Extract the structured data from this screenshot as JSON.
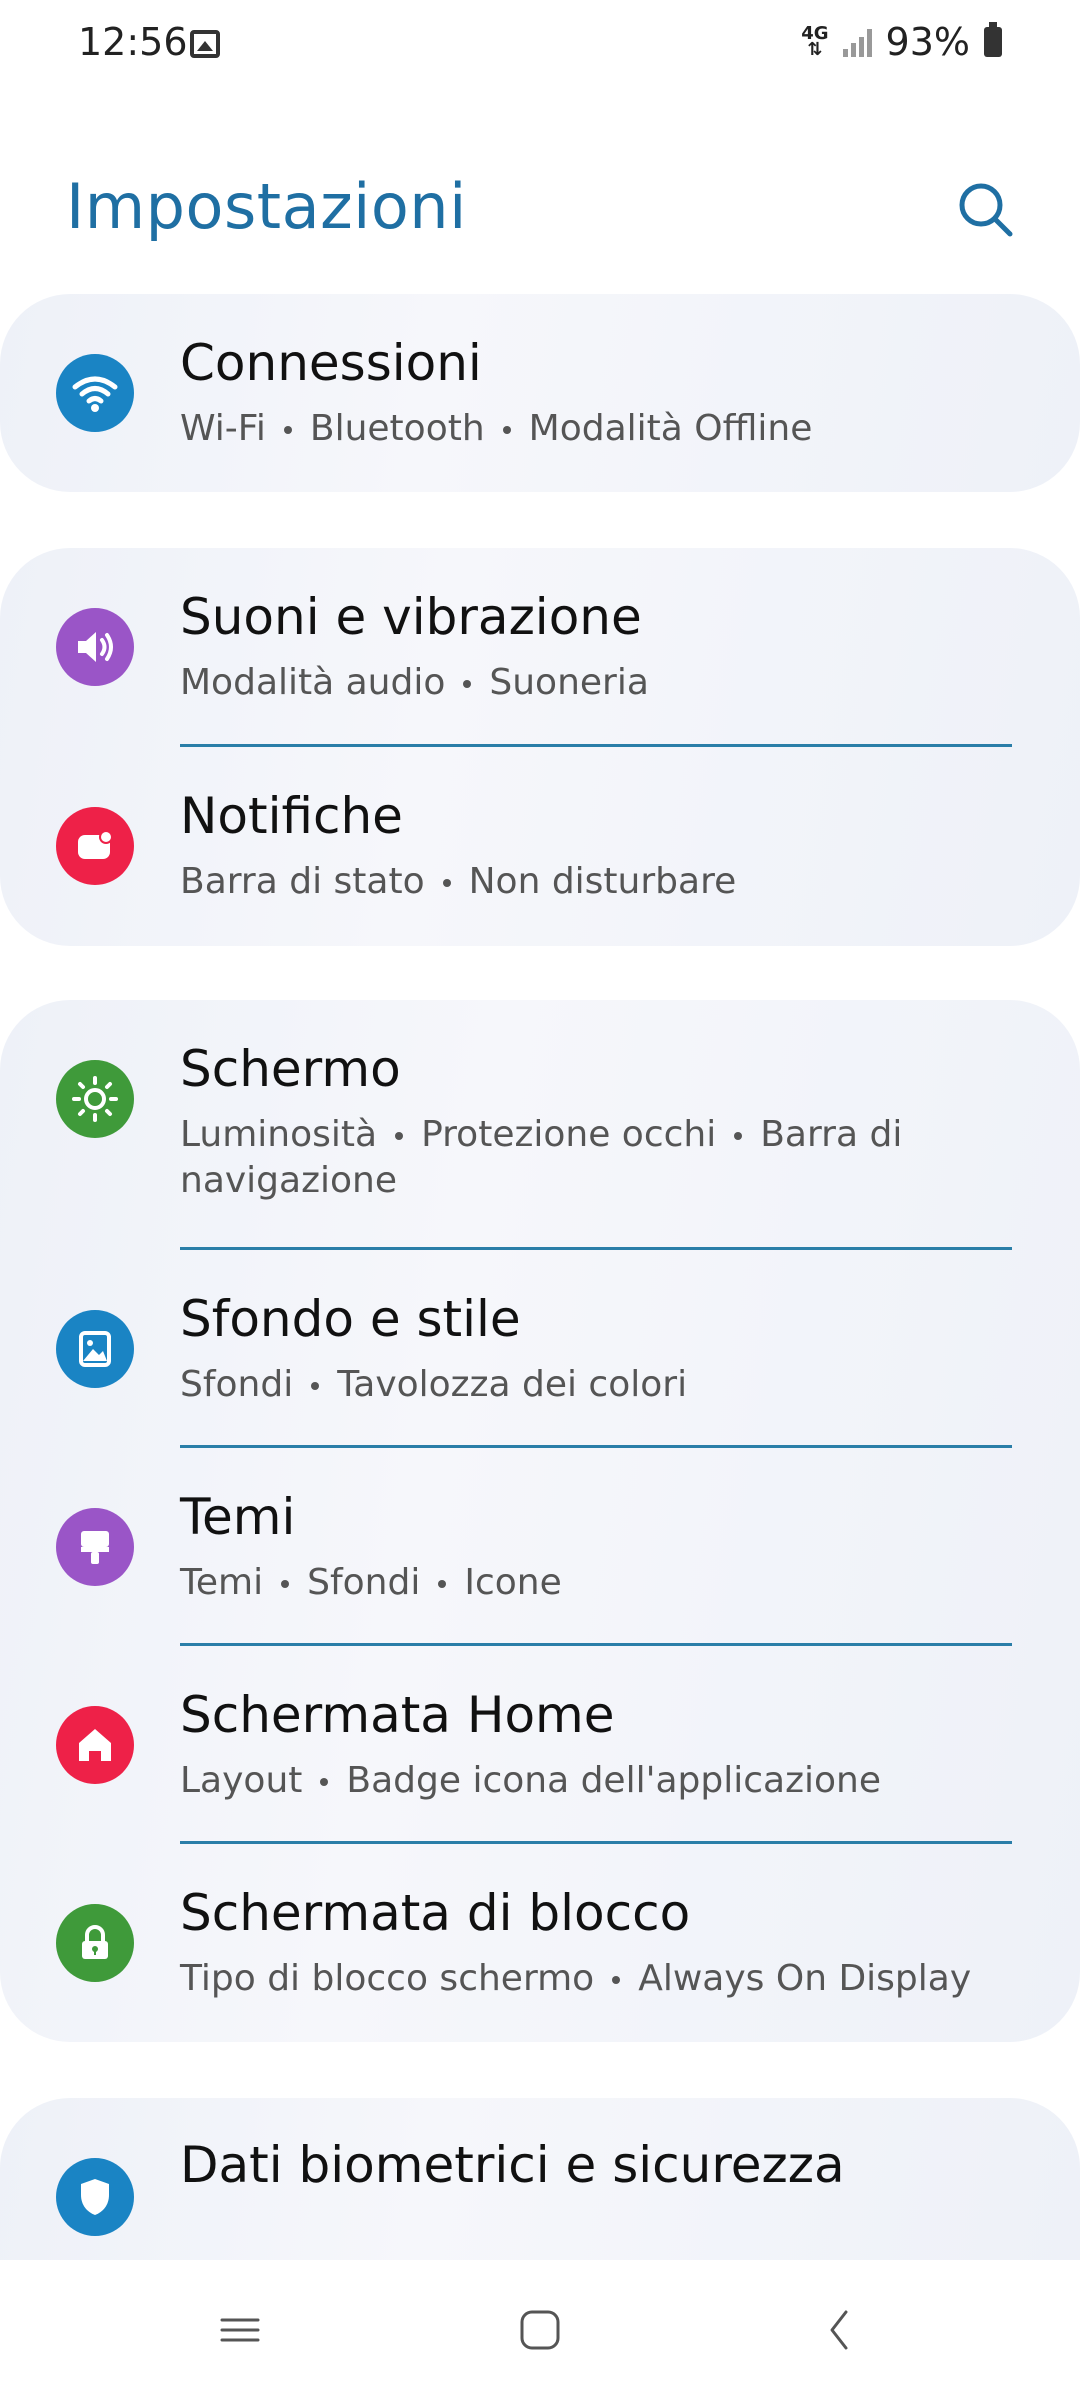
{
  "status": {
    "time": "12:56",
    "network": "4G",
    "battery": "93%"
  },
  "header": {
    "title": "Impostazioni"
  },
  "colors": {
    "accent": "#1f6fa3",
    "connessioni": "#1a84c4",
    "suoni": "#9a55c7",
    "notifiche": "#ee2148",
    "schermo": "#3f9a3a",
    "sfondo": "#1a84c4",
    "temi": "#9a55c7",
    "home": "#ee2148",
    "blocco": "#3f9a3a",
    "biometrici": "#1a84c4"
  },
  "groups": [
    {
      "items": [
        {
          "title": "Connessioni",
          "icon": "wifi-icon",
          "subtitle": [
            "Wi-Fi",
            "Bluetooth",
            "Modalità Offline"
          ]
        }
      ]
    },
    {
      "items": [
        {
          "title": "Suoni e vibrazione",
          "icon": "speaker-icon",
          "subtitle": [
            "Modalità audio",
            "Suoneria"
          ]
        },
        {
          "title": "Notifiche",
          "icon": "notification-icon",
          "subtitle": [
            "Barra di stato",
            "Non disturbare"
          ]
        }
      ]
    },
    {
      "items": [
        {
          "title": "Schermo",
          "icon": "brightness-icon",
          "subtitle": [
            "Luminosità",
            "Protezione occhi",
            "Barra di navigazione"
          ]
        },
        {
          "title": "Sfondo e stile",
          "icon": "wallpaper-icon",
          "subtitle": [
            "Sfondi",
            "Tavolozza dei colori"
          ]
        },
        {
          "title": "Temi",
          "icon": "brush-icon",
          "subtitle": [
            "Temi",
            "Sfondi",
            "Icone"
          ]
        },
        {
          "title": "Schermata Home",
          "icon": "home-icon",
          "subtitle": [
            "Layout",
            "Badge icona dell'applicazione"
          ]
        },
        {
          "title": "Schermata di blocco",
          "icon": "lock-icon",
          "subtitle": [
            "Tipo di blocco schermo",
            "Always On Display"
          ]
        }
      ]
    },
    {
      "items": [
        {
          "title": "Dati biometrici e sicurezza",
          "icon": "shield-icon",
          "subtitle": []
        }
      ]
    }
  ],
  "navbar": {
    "recents": "recents-icon",
    "home": "home-nav-icon",
    "back": "back-icon"
  }
}
